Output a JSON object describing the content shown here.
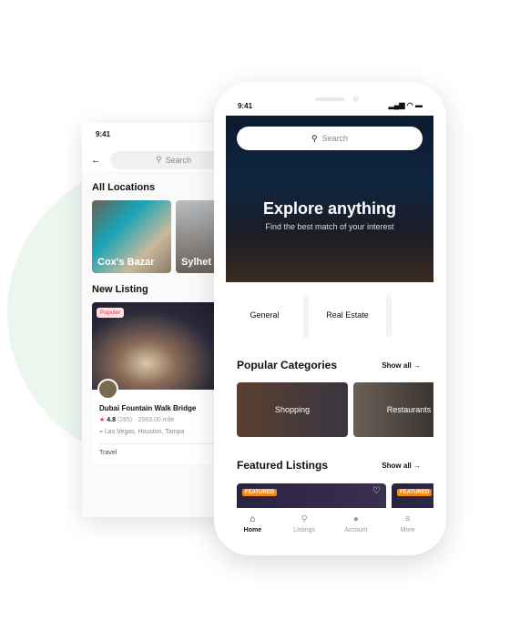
{
  "back_screen": {
    "status_time": "9:41",
    "search_placeholder": "Search",
    "all_locations_title": "All Locations",
    "locations": [
      {
        "name": "Cox's Bazar"
      },
      {
        "name": "Sylhet"
      }
    ],
    "new_listing_title": "New Listing",
    "listing": {
      "badge": "Populer",
      "title": "Dubai Fountain Walk Bridge",
      "rating": "4.8",
      "reviews": "(265)",
      "distance": "· 2563.00  mile",
      "location": "Las Vegas, Houston, Tampa",
      "category": "Travel"
    }
  },
  "front_screen": {
    "status_time": "9:41",
    "search_placeholder": "Search",
    "hero_title": "Explore anything",
    "hero_subtitle": "Find the best match of your interest",
    "tabs": [
      {
        "label": "General"
      },
      {
        "label": "Real Estate"
      },
      {
        "label": ""
      }
    ],
    "popular_title": "Popular Categories",
    "show_all": "Show all",
    "categories": [
      {
        "label": "Shopping"
      },
      {
        "label": "Restaurants"
      }
    ],
    "featured_title": "Featured Listings",
    "featured_badge": "FEATURED",
    "nav": [
      {
        "label": "Home",
        "icon": "home-icon"
      },
      {
        "label": "Listings",
        "icon": "search-icon"
      },
      {
        "label": "Account",
        "icon": "user-icon"
      },
      {
        "label": "More",
        "icon": "menu-icon"
      }
    ]
  },
  "colors": {
    "accent_green_bg": "#eaf6ee",
    "badge_orange": "#f08a1c",
    "popular_red": "#e0364a"
  }
}
